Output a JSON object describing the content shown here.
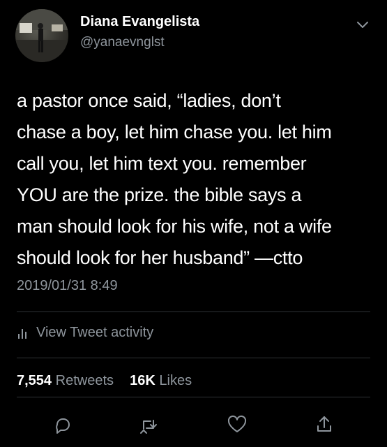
{
  "profile": {
    "name": "Diana Evangelista",
    "handle": "@yanaevnglst",
    "avatar_icon": "avatar-photo"
  },
  "tweet": {
    "text": "a pastor once said, “ladies, don’t\nchase a boy, let him chase you. let him\ncall you, let him text you. remember\nYOU are the prize. the bible says a\nman should look for his wife, not a wife\nshould look for her husband”  —ctto",
    "timestamp": "2019/01/31 8:49"
  },
  "activity": {
    "label": "View Tweet activity",
    "icon": "bar-chart-icon"
  },
  "stats": {
    "retweets_count": "7,554",
    "retweets_label": "Retweets",
    "likes_count": "16K",
    "likes_label": "Likes"
  },
  "actions": {
    "icons": [
      "reply-icon",
      "retweet-icon",
      "like-icon",
      "share-icon"
    ]
  },
  "colors": {
    "background": "#000000",
    "text": "#ffffff",
    "secondary": "#8e959c",
    "divider": "#2f3336"
  }
}
